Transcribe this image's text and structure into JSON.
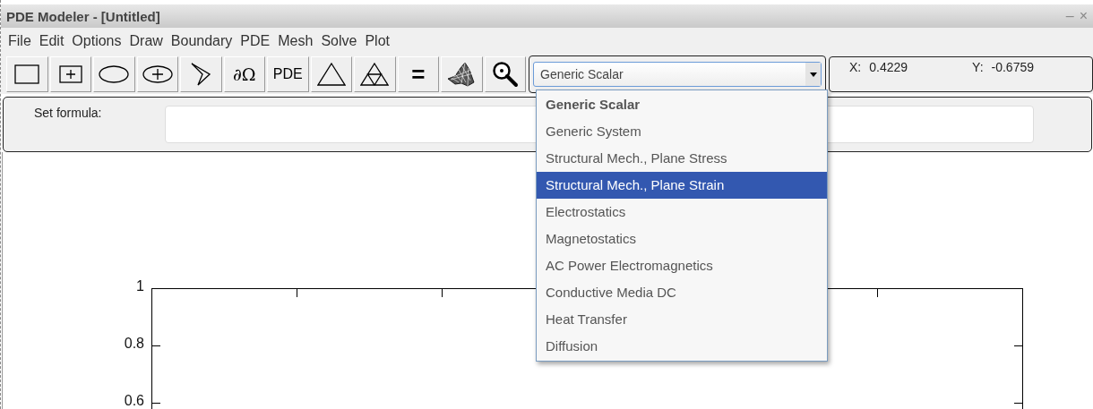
{
  "window": {
    "title": "PDE Modeler - [Untitled]",
    "controls": [
      "–",
      "×"
    ]
  },
  "menu": [
    "File",
    "Edit",
    "Options",
    "Draw",
    "Boundary",
    "PDE",
    "Mesh",
    "Solve",
    "Plot"
  ],
  "toolbar": [
    {
      "kind": "icon"
    },
    {
      "kind": "icon"
    },
    {
      "kind": "icon"
    },
    {
      "kind": "icon"
    },
    {
      "kind": "icon"
    },
    {
      "kind": "text",
      "label": "∂Ω"
    },
    {
      "kind": "text",
      "label": "PDE"
    },
    {
      "kind": "icon"
    },
    {
      "kind": "icon"
    },
    {
      "kind": "text",
      "label": "="
    },
    {
      "kind": "icon"
    },
    {
      "kind": "icon"
    }
  ],
  "application_mode": {
    "value": "Generic Scalar",
    "expanded": true,
    "options": [
      {
        "label": "Generic Scalar",
        "selected": true,
        "highlighted": false
      },
      {
        "label": "Generic System",
        "selected": false,
        "highlighted": false
      },
      {
        "label": "Structural Mech., Plane Stress",
        "selected": false,
        "highlighted": false
      },
      {
        "label": "Structural Mech., Plane Strain",
        "selected": false,
        "highlighted": true
      },
      {
        "label": "Electrostatics",
        "selected": false,
        "highlighted": false
      },
      {
        "label": "Magnetostatics",
        "selected": false,
        "highlighted": false
      },
      {
        "label": "AC Power Electromagnetics",
        "selected": false,
        "highlighted": false
      },
      {
        "label": "Conductive Media DC",
        "selected": false,
        "highlighted": false
      },
      {
        "label": "Heat Transfer",
        "selected": false,
        "highlighted": false
      },
      {
        "label": "Diffusion",
        "selected": false,
        "highlighted": false
      }
    ]
  },
  "coordinates": {
    "x_label": "X:",
    "x_value": "0.4229",
    "y_label": "Y:",
    "y_value": "-0.6759"
  },
  "formula": {
    "label": "Set formula:"
  },
  "axes": {
    "y_tick_labels": [
      "1",
      "0.8",
      "0.6"
    ]
  }
}
